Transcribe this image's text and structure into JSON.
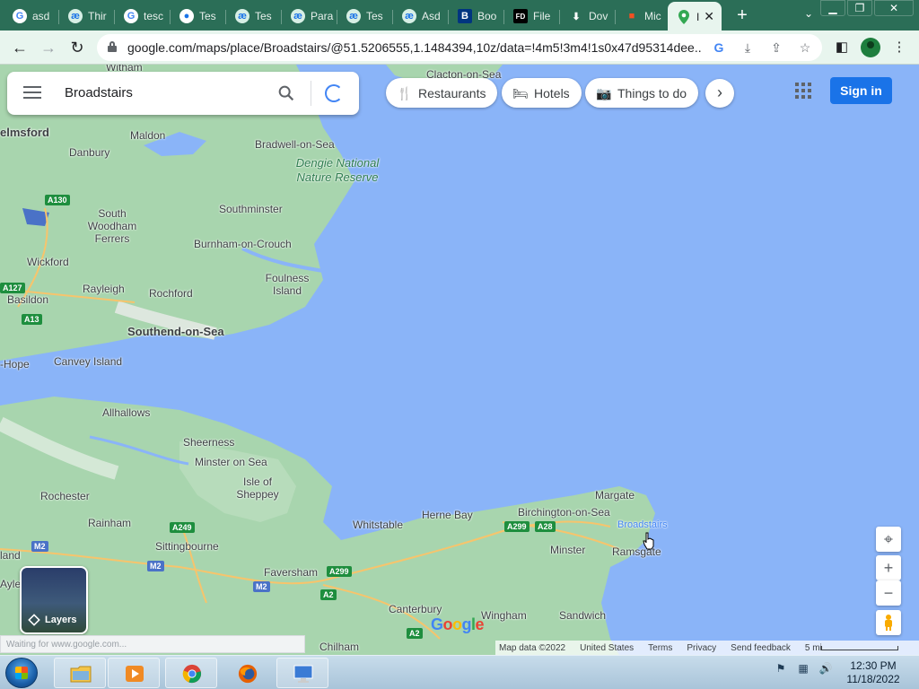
{
  "tabs": [
    {
      "label": "asd",
      "favicon": "google-icon"
    },
    {
      "label": "Thir",
      "favicon": "tab-app-icon"
    },
    {
      "label": "tesc",
      "favicon": "google-icon"
    },
    {
      "label": "Tes",
      "favicon": "chrome-web-icon"
    },
    {
      "label": "Tes",
      "favicon": "tab-app-icon"
    },
    {
      "label": "Para",
      "favicon": "tab-app-icon"
    },
    {
      "label": "Tes",
      "favicon": "tab-app-icon"
    },
    {
      "label": "Asd",
      "favicon": "tab-app-icon"
    },
    {
      "label": "Boo",
      "favicon": "booking-icon"
    },
    {
      "label": "File",
      "favicon": "fd-icon"
    },
    {
      "label": "Dov",
      "favicon": "download-icon"
    },
    {
      "label": "Mic",
      "favicon": "microsoft-icon"
    }
  ],
  "active_tab": {
    "label": "I",
    "favicon": "maps-pin-icon"
  },
  "url": "google.com/maps/place/Broadstairs/@51.5206555,1.1484394,10z/data=!4m5!3m4!1s0x47d95314dee...",
  "search": {
    "value": "Broadstairs"
  },
  "chips": [
    "Restaurants",
    "Hotels",
    "Things to do"
  ],
  "signin": "Sign in",
  "layers": "Layers",
  "map_labels": {
    "witham": "Witham",
    "clacton": "Clacton-on-Sea",
    "chelmsford": "elmsford",
    "maldon": "Maldon",
    "danbury": "Danbury",
    "bradwell": "Bradwell-on-Sea",
    "dengie": "Dengie National Nature Reserve",
    "southminster": "Southminster",
    "south_woodham": "South Woodham Ferrers",
    "burnham": "Burnham-on-Crouch",
    "wickford": "Wickford",
    "rayleigh": "Rayleigh",
    "rochford": "Rochford",
    "foulness": "Foulness Island",
    "basildon": "Basildon",
    "southend": "Southend-on-Sea",
    "hope": "-Hope",
    "canvey": "Canvey Island",
    "allhallows": "Allhallows",
    "sheerness": "Sheerness",
    "minster_sea": "Minster on Sea",
    "isle_sheppey": "Isle of Sheppey",
    "rochester": "Rochester",
    "rainham": "Rainham",
    "sittingbourne": "Sittingbourne",
    "faversham": "Faversham",
    "whitstable": "Whitstable",
    "herne_bay": "Herne Bay",
    "birchington": "Birchington-on-Sea",
    "margate": "Margate",
    "broadstairs": "Broadstairs",
    "minster": "Minster",
    "ramsgate": "Ramsgate",
    "canterbury": "Canterbury",
    "wingham": "Wingham",
    "sandwich": "Sandwich",
    "chilham": "Chilham",
    "aylesford": "Ayle",
    "land": "land"
  },
  "road_shields": [
    "A130",
    "A127",
    "A13",
    "A249",
    "A299",
    "A28",
    "M2",
    "M2",
    "A299",
    "M2",
    "A2",
    "A2"
  ],
  "attribution": {
    "map_data": "Map data ©2022",
    "country": "United States",
    "terms": "Terms",
    "privacy": "Privacy",
    "feedback": "Send feedback",
    "scale": "5 mi"
  },
  "status_text": "Waiting for www.google.com...",
  "clock": {
    "time": "12:30 PM",
    "date": "11/18/2022"
  },
  "colors": {
    "tabstrip": "#2b6e57",
    "water": "#8ab4f8",
    "land": "#a8d5ae",
    "accent": "#1a73e8"
  }
}
